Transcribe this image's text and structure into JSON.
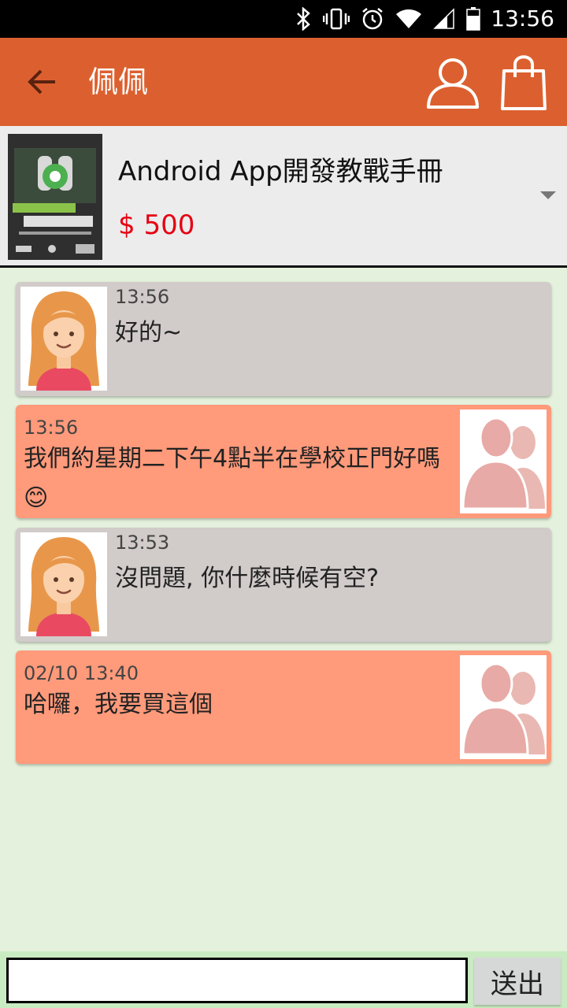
{
  "status_bar": {
    "time": "13:56",
    "icons": [
      "bluetooth-icon",
      "vibrate-icon",
      "alarm-icon",
      "wifi-icon",
      "signal-icon",
      "battery-icon"
    ]
  },
  "app_bar": {
    "title": "佩佩",
    "back_icon": "arrow-back-icon",
    "actions": [
      "profile-icon",
      "shopping-bag-icon"
    ],
    "color": "#dc602f"
  },
  "product": {
    "name": "Android App開發教戰手冊",
    "price": "$ 500",
    "price_color": "#e60012",
    "cover_icon": "book-cover-image"
  },
  "messages": [
    {
      "side": "incoming",
      "time": "13:56",
      "text": "好的~",
      "avatar": "girl-avatar"
    },
    {
      "side": "outgoing",
      "time": "13:56",
      "text": "我們約星期二下午4點半在學校正門好嗎 😊",
      "avatar": "people-silhouette-avatar"
    },
    {
      "side": "incoming",
      "time": "13:53",
      "text": "沒問題, 你什麼時候有空?",
      "avatar": "girl-avatar"
    },
    {
      "side": "outgoing",
      "time": "02/10  13:40",
      "text": "哈囉，我要買這個",
      "avatar": "people-silhouette-avatar"
    }
  ],
  "colors": {
    "incoming_bubble": "#d1cbca",
    "outgoing_bubble": "#ff9a7b",
    "chat_background": "#e4f1dc"
  },
  "input_bar": {
    "value": "",
    "send_label": "送出"
  }
}
